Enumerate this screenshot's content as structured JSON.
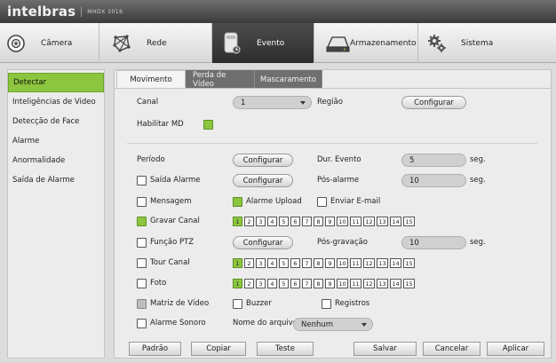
{
  "header": {
    "brand": "intelbras",
    "model": "MHDX 3016"
  },
  "mainmenu": {
    "items": [
      {
        "label": "Câmera",
        "icon": "camera-icon"
      },
      {
        "label": "Rede",
        "icon": "network-icon"
      },
      {
        "label": "Evento",
        "icon": "event-icon",
        "active": true
      },
      {
        "label": "Armazenamento",
        "icon": "storage-icon"
      },
      {
        "label": "Sistema",
        "icon": "gears-icon"
      }
    ]
  },
  "sidebar": {
    "items": [
      {
        "label": "Detectar",
        "active": true
      },
      {
        "label": "Inteligências de Video"
      },
      {
        "label": "Detecção de Face"
      },
      {
        "label": "Alarme"
      },
      {
        "label": "Anormalidade"
      },
      {
        "label": "Saída de Alarme"
      }
    ]
  },
  "tabs": [
    {
      "label": "Movimento",
      "active": true
    },
    {
      "label": "Perda de Vídeo"
    },
    {
      "label": "Mascaramento"
    }
  ],
  "form": {
    "canal_label": "Canal",
    "canal_value": "1",
    "regiao_label": "Região",
    "configurar": "Configurar",
    "habilitar_md_label": "Habilitar MD",
    "habilitar_md": true,
    "periodo_label": "Período",
    "dur_evento_label": "Dur. Evento",
    "dur_evento_value": "5",
    "seg": "seg.",
    "saida_alarme_label": "Saída Alarme",
    "saida_alarme": false,
    "pos_alarme_label": "Pós-alarme",
    "pos_alarme_value": "10",
    "mensagem_label": "Mensagem",
    "mensagem": false,
    "alarme_upload_label": "Alarme Upload",
    "alarme_upload": true,
    "enviar_email_label": "Enviar E-mail",
    "enviar_email": false,
    "gravar_canal_label": "Gravar Canal",
    "gravar_canal": true,
    "funcao_ptz_label": "Função PTZ",
    "funcao_ptz": false,
    "pos_gravacao_label": "Pós-gravação",
    "pos_gravacao_value": "10",
    "tour_canal_label": "Tour Canal",
    "tour_canal": false,
    "foto_label": "Foto",
    "foto": false,
    "matriz_label": "Matriz de Vídeo",
    "matriz": false,
    "buzzer_label": "Buzzer",
    "buzzer": false,
    "registros_label": "Registros",
    "registros": false,
    "alarme_sonoro_label": "Alarme Sonoro",
    "alarme_sonoro": false,
    "nome_arquivo_label": "Nome do arquivo",
    "nome_arquivo_value": "Nenhum"
  },
  "channels": [
    "1",
    "2",
    "3",
    "4",
    "5",
    "6",
    "7",
    "8",
    "9",
    "10",
    "11",
    "12",
    "13",
    "14",
    "15"
  ],
  "selected_channels": {
    "gravar": [
      "1"
    ],
    "tour": [
      "1"
    ],
    "foto": [
      "1"
    ]
  },
  "footer": {
    "padrao": "Padrão",
    "copiar": "Copiar",
    "teste": "Teste",
    "salvar": "Salvar",
    "cancelar": "Cancelar",
    "aplicar": "Aplicar"
  },
  "colors": {
    "accent": "#8cc63f",
    "header": "#3a3a3a"
  }
}
